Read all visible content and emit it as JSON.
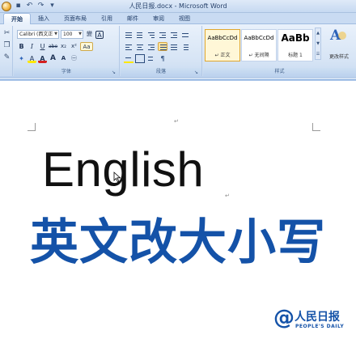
{
  "window": {
    "title": "人民日报.docx - Microsoft Word"
  },
  "quick_access": {
    "icons": [
      "office-button",
      "save-icon",
      "undo-icon",
      "redo-icon",
      "customize-icon"
    ]
  },
  "tabs": [
    {
      "label": "开始",
      "active": true
    },
    {
      "label": "插入",
      "active": false
    },
    {
      "label": "页面布局",
      "active": false
    },
    {
      "label": "引用",
      "active": false
    },
    {
      "label": "邮件",
      "active": false
    },
    {
      "label": "审阅",
      "active": false
    },
    {
      "label": "视图",
      "active": false
    }
  ],
  "ribbon": {
    "font": {
      "group_label": "字体",
      "font_name": "Calibri (西文正",
      "font_size": "100",
      "bold": "B",
      "italic": "I",
      "underline": "U",
      "strike": "abe",
      "subscript": "x₂",
      "superscript": "x²",
      "change_case": "Aa",
      "font_color": "A",
      "highlight": "A",
      "grow": "A",
      "shrink": "A",
      "phonetic": "變",
      "char_border": "A"
    },
    "paragraph": {
      "group_label": "段落"
    },
    "styles": {
      "group_label": "样式",
      "items": [
        {
          "sample": "AaBbCcDd",
          "name": "↵ 正文",
          "selected": true
        },
        {
          "sample": "AaBbCcDd",
          "name": "↵ 无间隔",
          "selected": false
        },
        {
          "sample": "AaBb",
          "name": "标题 1",
          "selected": false
        }
      ],
      "change_styles_label": "更改样式"
    }
  },
  "document": {
    "text_line": "English",
    "headline": "英文改大小写",
    "paragraph_mark": "↵"
  },
  "watermark": {
    "symbol": "@",
    "name_cn": "人民日报",
    "name_en": "PEOPLE'S DAILY"
  },
  "colors": {
    "accent_blue": "#1452a8",
    "ribbon_bg": "#d6e4f5",
    "font_color_red": "#d42020",
    "highlight_yellow": "#ffe800"
  }
}
